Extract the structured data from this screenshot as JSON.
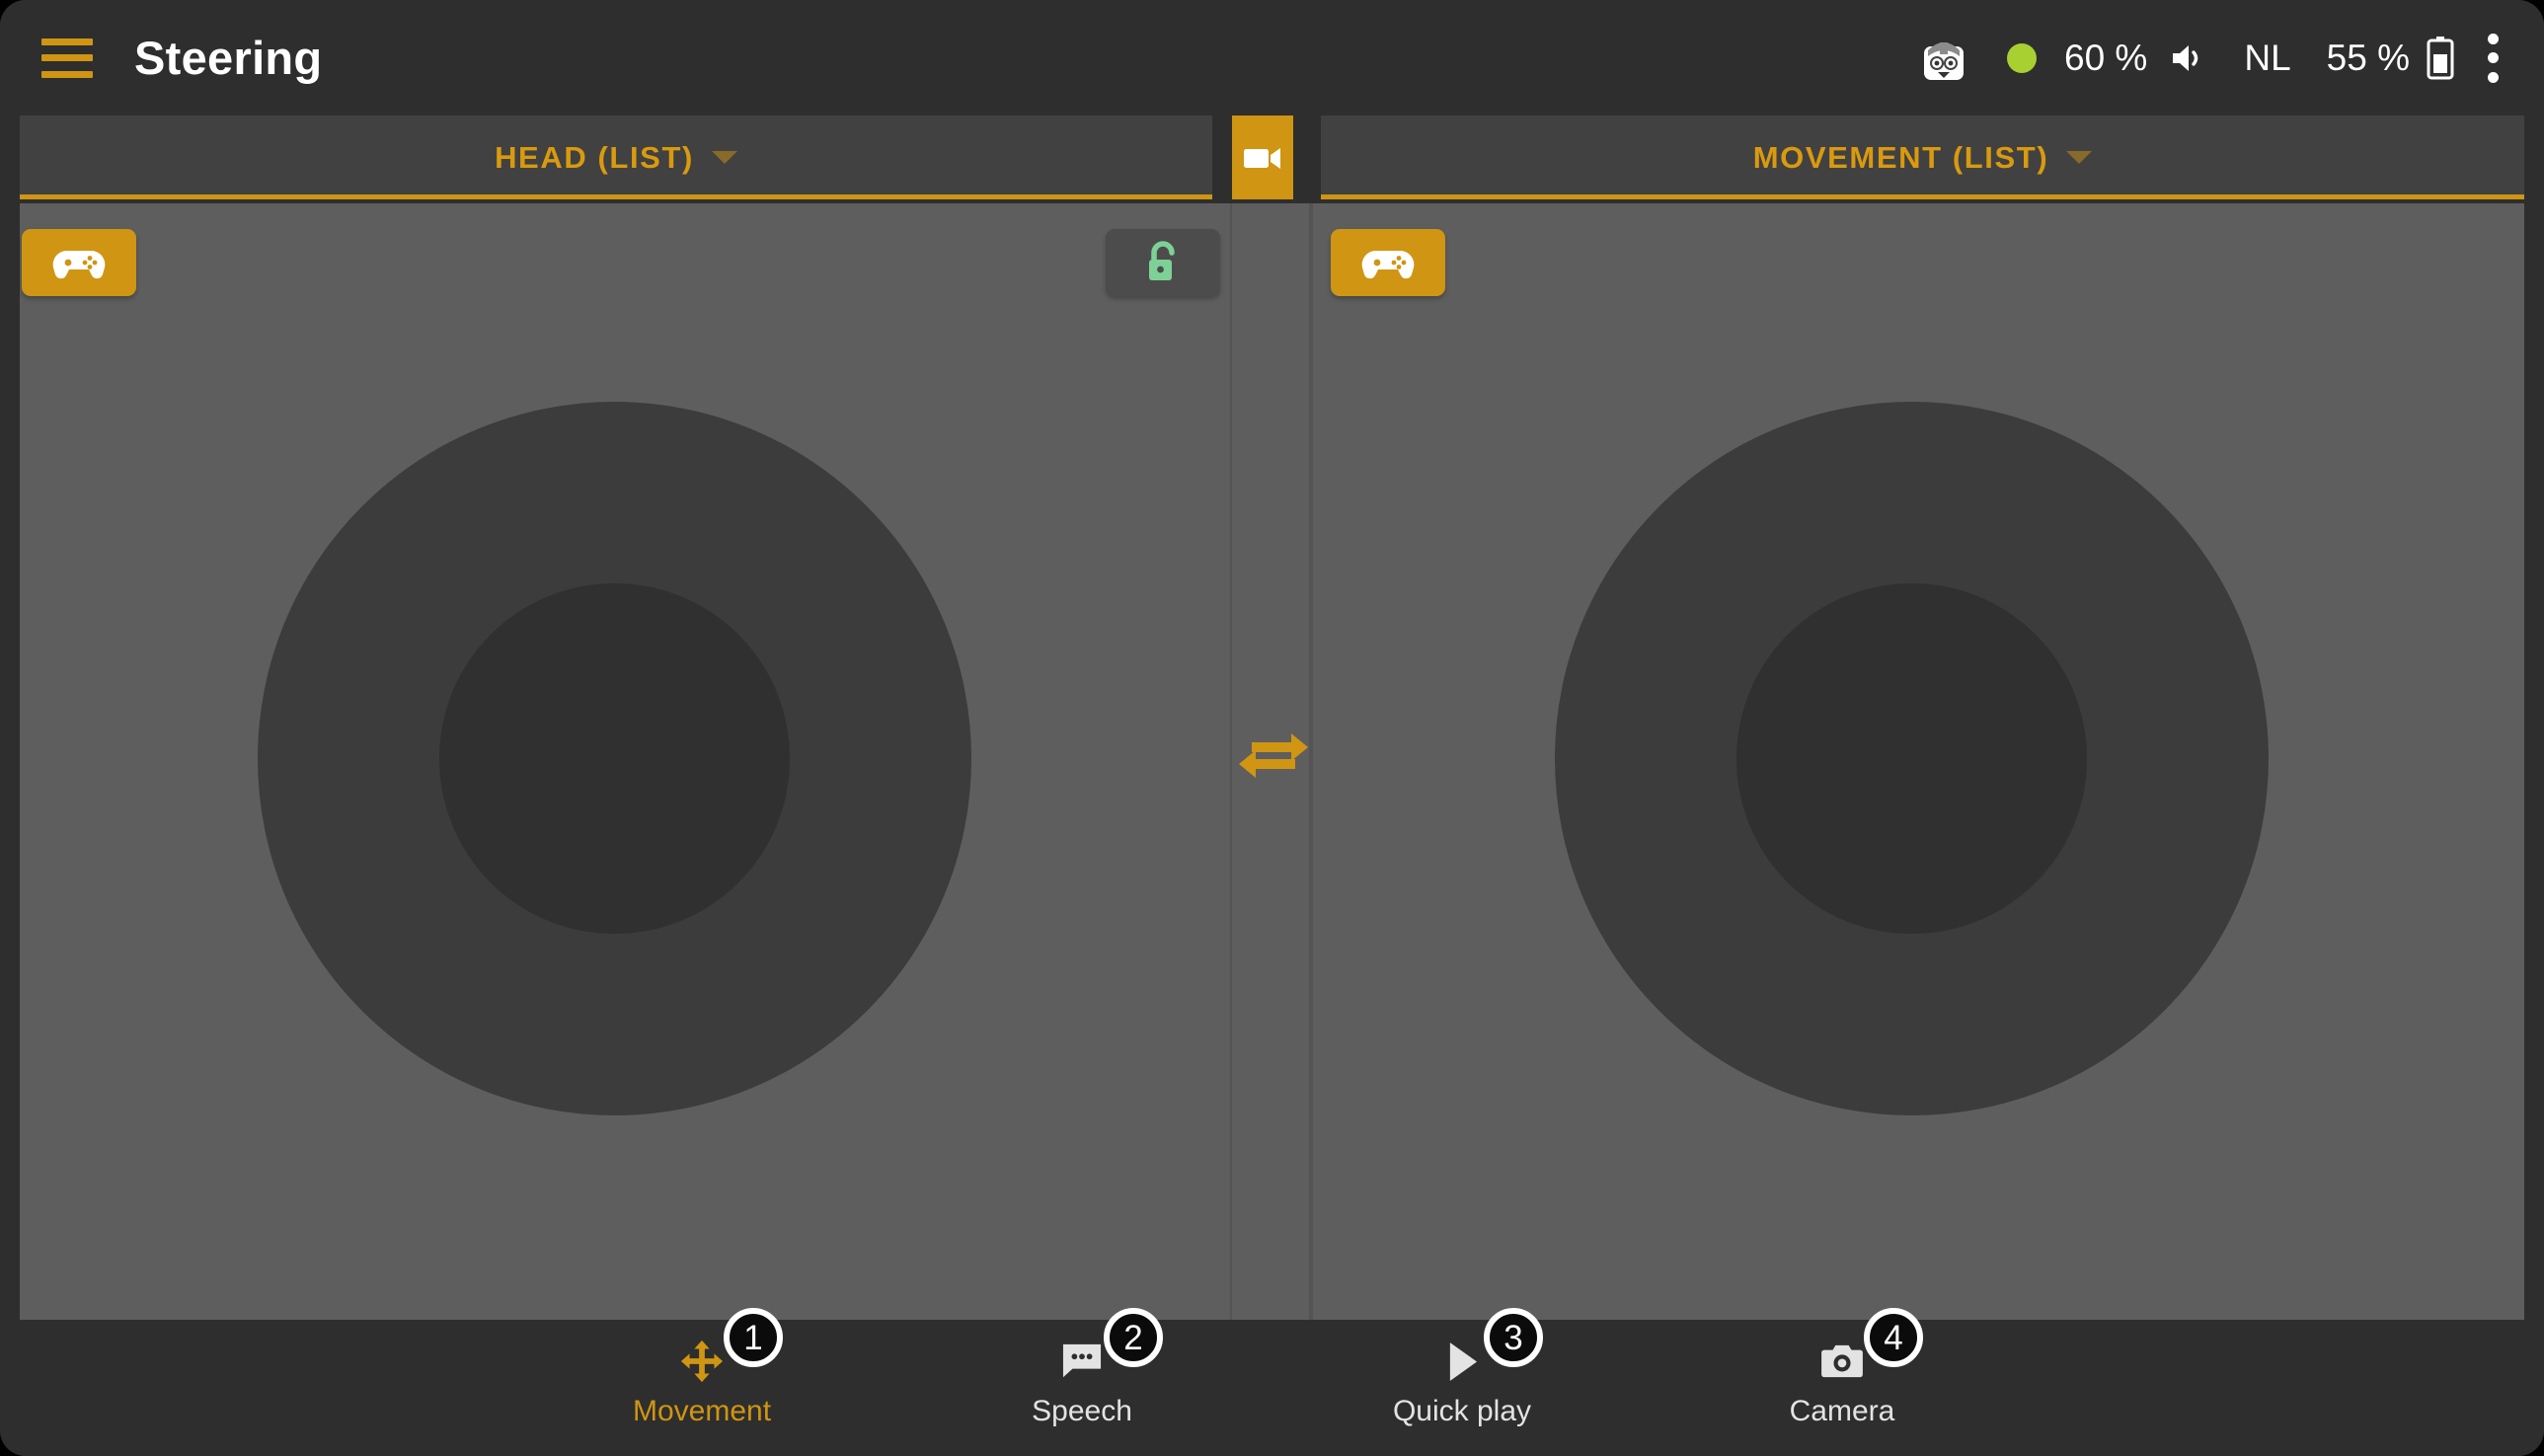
{
  "header": {
    "menu_icon": "hamburger-menu-icon",
    "title": "Steering",
    "status": {
      "robot_icon": "robot-head-icon",
      "connection_dot_color": "#a8d030",
      "volume_value": "60 %",
      "speaker_icon": "speaker-volume-icon",
      "language": "NL",
      "battery_value": "55 %",
      "battery_icon": "battery-icon",
      "overflow_icon": "more-vertical-icon"
    }
  },
  "panels": {
    "left": {
      "tab_label": "HEAD (LIST)",
      "caret_icon": "chevron-down-icon",
      "gamepad_icon": "gamepad-icon",
      "lock_icon": "lock-open-icon",
      "lock_color": "#7ed196",
      "joystick_name": "head-joystick"
    },
    "right": {
      "tab_label": "MOVEMENT (LIST)",
      "caret_icon": "chevron-down-icon",
      "gamepad_icon": "gamepad-icon",
      "joystick_name": "movement-joystick"
    },
    "center": {
      "camera_toggle_icon": "video-camera-icon",
      "swap_icon": "swap-horizontal-icon"
    }
  },
  "bottom_nav": {
    "items": [
      {
        "label": "Movement",
        "icon": "move-arrows-icon",
        "badge": "1",
        "active": true
      },
      {
        "label": "Speech",
        "icon": "chat-bubble-icon",
        "badge": "2",
        "active": false
      },
      {
        "label": "Quick play",
        "icon": "play-icon",
        "badge": "3",
        "active": false
      },
      {
        "label": "Camera",
        "icon": "photo-camera-icon",
        "badge": "4",
        "active": false
      }
    ]
  },
  "colors": {
    "accent": "#cf9513",
    "accent_text": "#d99a0f",
    "bg_dark": "#2e2e2e",
    "panel_bg": "#5e5e5e",
    "joystick_outer": "#3c3c3c",
    "joystick_inner": "#303030",
    "status_ok": "#a8d030"
  }
}
